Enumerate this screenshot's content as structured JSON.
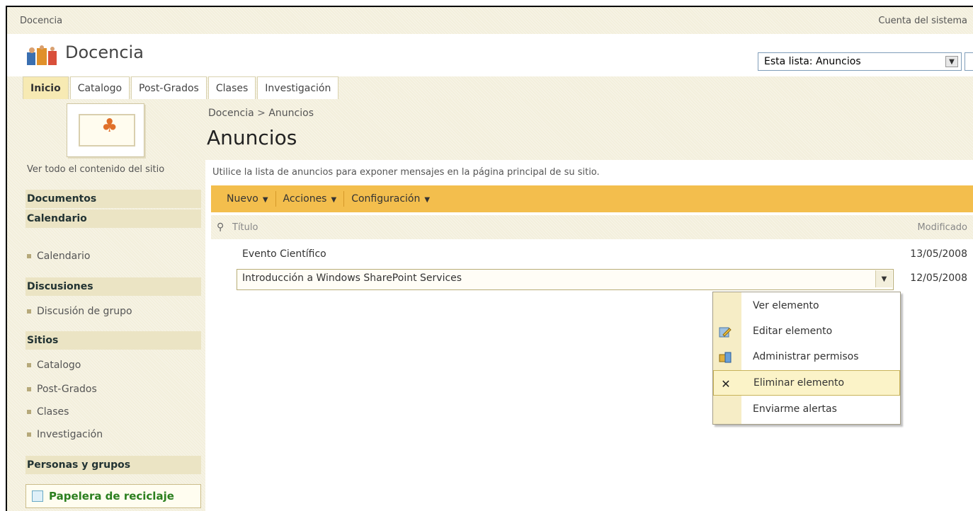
{
  "topbar": {
    "site_link": "Docencia",
    "account": "Cuenta del sistema"
  },
  "header": {
    "site_title": "Docencia",
    "search_scope": "Esta lista: Anuncios"
  },
  "tabs": [
    {
      "label": "Inicio",
      "active": true
    },
    {
      "label": "Catalogo"
    },
    {
      "label": "Post-Grados"
    },
    {
      "label": "Clases"
    },
    {
      "label": "Investigación"
    }
  ],
  "page": {
    "breadcrumb_site": "Docencia",
    "breadcrumb_sep": " > ",
    "breadcrumb_current": "Anuncios",
    "title": "Anuncios",
    "description": "Utilice la lista de anuncios para exponer mensajes en la página principal de su sitio."
  },
  "nav": {
    "all_content": "Ver todo el contenido del sitio",
    "documents": "Documentos",
    "calendar_head": "Calendario",
    "calendar_item": "Calendario",
    "discussions_head": "Discusiones",
    "discussions_item": "Discusión de grupo",
    "sites_head": "Sitios",
    "sites": [
      "Catalogo",
      "Post-Grados",
      "Clases",
      "Investigación"
    ],
    "people": "Personas y grupos",
    "recycle": "Papelera de reciclaje"
  },
  "toolbar": {
    "new": "Nuevo",
    "actions": "Acciones",
    "settings": "Configuración"
  },
  "columns": {
    "title": "Título",
    "modified": "Modificado"
  },
  "rows": [
    {
      "title": "Evento Científico",
      "modified": "13/05/2008"
    },
    {
      "title": "Introducción a Windows SharePoint Services",
      "modified": "12/05/2008"
    }
  ],
  "context_menu": [
    {
      "label": "Ver elemento",
      "icon": ""
    },
    {
      "label": "Editar elemento",
      "icon": "edit-icon"
    },
    {
      "label": "Administrar permisos",
      "icon": "permissions-icon"
    },
    {
      "label": "Eliminar elemento",
      "icon": "delete-icon",
      "highlighted": true
    },
    {
      "label": "Enviarme alertas",
      "icon": ""
    }
  ],
  "colors": {
    "toolbar": "#f3be4d",
    "tab_active": "#f7eab3",
    "recycle_text": "#2b7f1e"
  }
}
